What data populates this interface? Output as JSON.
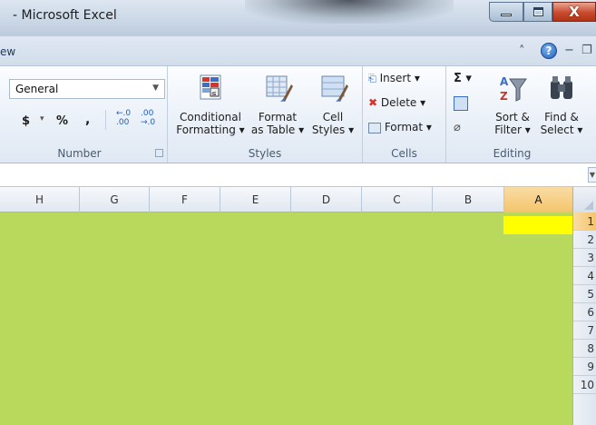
{
  "window": {
    "title": "- Microsoft Excel",
    "buttons": {
      "minimize": "minimize",
      "maximize": "maximize",
      "close": "close"
    }
  },
  "ribbon_tabs": {
    "visible_fragment": "ew",
    "right_icons": [
      "caret-up-icon",
      "help-icon",
      "minimize-ribbon-icon",
      "restore-window-icon"
    ]
  },
  "ribbon": {
    "number": {
      "label": "Number",
      "format_value": "General",
      "currency": "$",
      "currency_arrow": "▾",
      "percent": "%",
      "comma": ",",
      "increase_decimal": "←.0\n.00",
      "decrease_decimal": ".00\n→.0"
    },
    "styles": {
      "label": "Styles",
      "conditional_formatting": [
        "Conditional",
        "Formatting ▾"
      ],
      "format_as_table": [
        "Format",
        "as Table ▾"
      ],
      "cell_styles": [
        "Cell",
        "Styles ▾"
      ]
    },
    "cells": {
      "label": "Cells",
      "insert": "Insert ▾",
      "delete": "Delete ▾",
      "format": "Format ▾"
    },
    "editing": {
      "label": "Editing",
      "autosum": "Σ ▾",
      "sort_filter": [
        "Sort &",
        "Filter ▾"
      ],
      "find_select": [
        "Find &",
        "Select ▾"
      ]
    }
  },
  "grid": {
    "columns": [
      "H",
      "G",
      "F",
      "E",
      "D",
      "C",
      "B",
      "A"
    ],
    "selected_column": "A",
    "rows": [
      "1",
      "2",
      "3",
      "4",
      "5",
      "6",
      "7",
      "8",
      "9",
      "10"
    ],
    "selected_row": "1",
    "fill_color": "#b8d95c",
    "active_cell_color": "#ffff00"
  },
  "colors": {
    "ribbon_bg": "#eaf0f8",
    "accent": "#1f5fb8",
    "close_red": "#c94a2c"
  }
}
